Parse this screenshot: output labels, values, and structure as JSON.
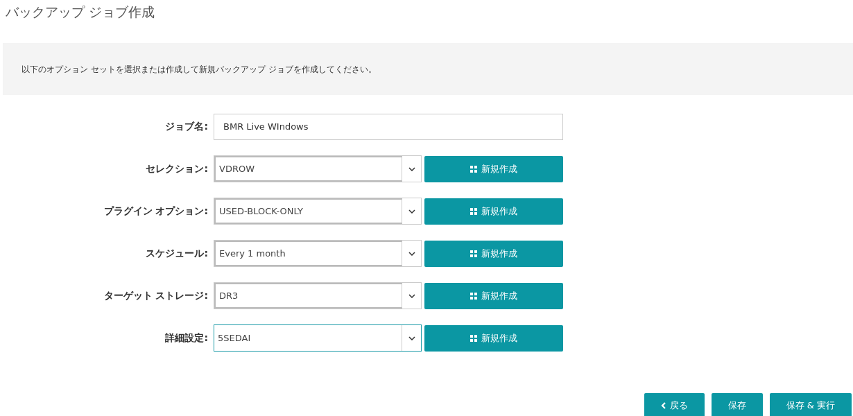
{
  "title": "バックアップ ジョブ作成",
  "instruction": "以下のオプション セットを選択または作成して新規バックアップ ジョブを作成してください。",
  "job_name": {
    "label": "ジョブ名:",
    "value": "BMR Live WIndows"
  },
  "options": [
    {
      "label": "セレクション:",
      "value": "VDROW",
      "focused": false,
      "button": "新規作成"
    },
    {
      "label": "プラグイン オプション:",
      "value": "USED-BLOCK-ONLY",
      "focused": false,
      "button": "新規作成"
    },
    {
      "label": "スケジュール:",
      "value": "Every 1 month",
      "focused": false,
      "button": "新規作成"
    },
    {
      "label": "ターゲット ストレージ:",
      "value": "DR3",
      "focused": false,
      "button": "新規作成"
    },
    {
      "label": "詳細設定:",
      "value": "5SEDAI",
      "focused": true,
      "button": "新規作成"
    }
  ],
  "actions": [
    {
      "kind": "back",
      "label": "戻る"
    },
    {
      "kind": "plain",
      "label": "保存"
    },
    {
      "kind": "plain",
      "label": "保存 & 実行"
    }
  ]
}
